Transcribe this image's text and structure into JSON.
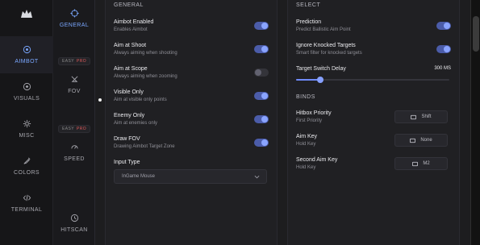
{
  "app": {
    "logo_icon": "wolf-logo-icon",
    "accent": "#7aa7ff"
  },
  "sidebar": {
    "items": [
      {
        "label": "AIMBOT",
        "icon": "target-icon"
      },
      {
        "label": "VISUALS",
        "icon": "eye-icon"
      },
      {
        "label": "MISC",
        "icon": "gear-icon"
      },
      {
        "label": "COLORS",
        "icon": "brush-icon"
      },
      {
        "label": "TERMINAL",
        "icon": "code-icon"
      }
    ]
  },
  "subnav": {
    "items": [
      {
        "label": "GENERAL",
        "icon": "crosshair-icon",
        "easy_label": "",
        "pro_label": ""
      },
      {
        "label": "FOV",
        "icon": "fov-icon",
        "easy_label": "EASY",
        "pro_label": "PRO"
      },
      {
        "label": "SPEED",
        "icon": "gauge-icon",
        "easy_label": "EASY",
        "pro_label": "PRO"
      },
      {
        "label": "HITSCAN",
        "icon": "clock-icon",
        "easy_label": "",
        "pro_label": ""
      }
    ]
  },
  "general": {
    "title": "GENERAL",
    "rows": [
      {
        "title": "Aimbot Enabled",
        "subtitle": "Enables Aimbot",
        "on": true
      },
      {
        "title": "Aim at Shoot",
        "subtitle": "Always aiming when shooting",
        "on": true
      },
      {
        "title": "Aim at Scope",
        "subtitle": "Always aiming when zooming",
        "on": false
      },
      {
        "title": "Visible Only",
        "subtitle": "Aim at visible only points",
        "on": true
      },
      {
        "title": "Enemy Only",
        "subtitle": "Aim at enemies only",
        "on": true
      },
      {
        "title": "Draw FOV",
        "subtitle": "Drawing Aimbot Target Zone",
        "on": true
      }
    ],
    "input_type_label": "Input Type",
    "input_type_value": "InGame Mouse"
  },
  "select": {
    "title": "SELECT",
    "rows": [
      {
        "title": "Prediction",
        "subtitle": "Predict Ballistic Aim Point",
        "on": true
      },
      {
        "title": "Ignore Knocked Targets",
        "subtitle": "Smart filter for knocked targets",
        "on": true
      }
    ],
    "slider": {
      "label": "Target Switch Delay",
      "value_text": "300 MS",
      "fraction": 0.16
    }
  },
  "binds": {
    "title": "BINDS",
    "items": [
      {
        "title": "Hitbox Priority",
        "subtitle": "First Priority",
        "value": "Shift",
        "icon": "keyboard-icon"
      },
      {
        "title": "Aim Key",
        "subtitle": "Hold Key",
        "value": "None",
        "icon": "keyboard-icon"
      },
      {
        "title": "Second Aim Key",
        "subtitle": "Hold Key",
        "value": "M2",
        "icon": "keyboard-icon"
      }
    ]
  }
}
